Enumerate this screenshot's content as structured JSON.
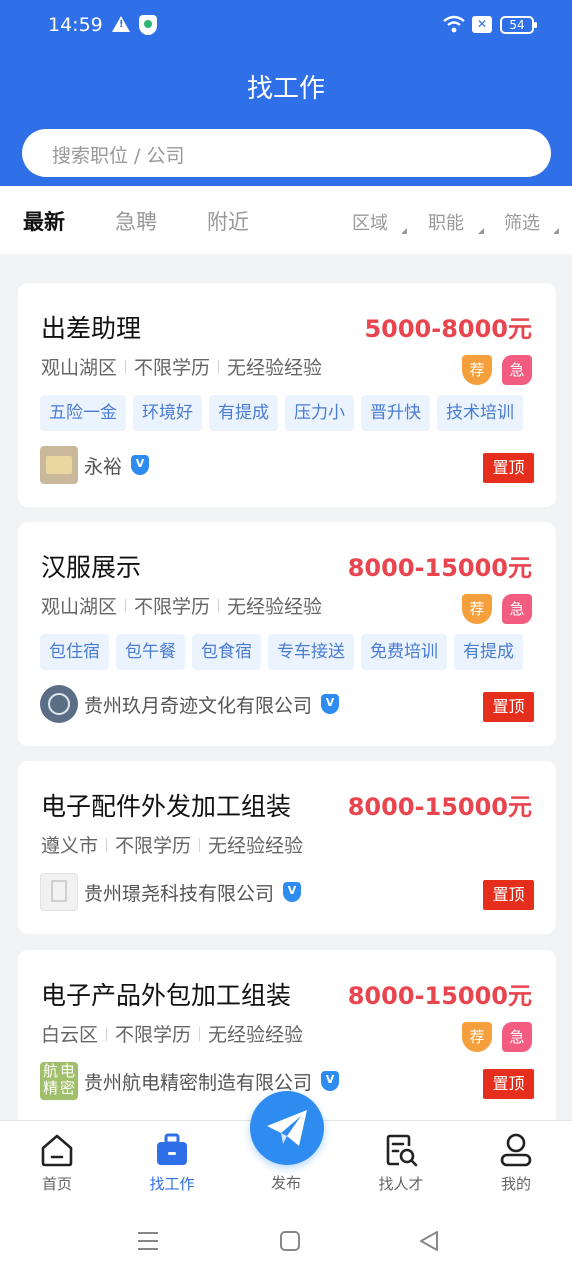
{
  "status_bar": {
    "time": "14:59",
    "battery": "54"
  },
  "header": {
    "title": "找工作"
  },
  "search": {
    "placeholder": "搜索职位 / 公司"
  },
  "tabs": [
    {
      "label": "最新",
      "active": true
    },
    {
      "label": "急聘",
      "active": false
    },
    {
      "label": "附近",
      "active": false
    }
  ],
  "filters": [
    {
      "label": "区域"
    },
    {
      "label": "职能"
    },
    {
      "label": "筛选"
    }
  ],
  "jobs": [
    {
      "title": "出差助理",
      "salary": "5000-8000元",
      "meta": [
        "观山湖区",
        "不限学历",
        "无经验经验"
      ],
      "badges": [
        "荐",
        "急"
      ],
      "tags": [
        "五险一金",
        "环境好",
        "有提成",
        "压力小",
        "晋升快",
        "技术培训"
      ],
      "company": "永裕",
      "verified": "V",
      "pin": "置顶"
    },
    {
      "title": "汉服展示",
      "salary": "8000-15000元",
      "meta": [
        "观山湖区",
        "不限学历",
        "无经验经验"
      ],
      "badges": [
        "荐",
        "急"
      ],
      "tags": [
        "包住宿",
        "包午餐",
        "包食宿",
        "专车接送",
        "免费培训",
        "有提成"
      ],
      "company": "贵州玖月奇迹文化有限公司",
      "verified": "V",
      "pin": "置顶"
    },
    {
      "title": "电子配件外发加工组装",
      "salary": "8000-15000元",
      "meta": [
        "遵义市",
        "不限学历",
        "无经验经验"
      ],
      "badges": [],
      "tags": [],
      "company": "贵州璟尧科技有限公司",
      "verified": "V",
      "pin": "置顶"
    },
    {
      "title": "电子产品外包加工组装",
      "salary": "8000-15000元",
      "meta": [
        "白云区",
        "不限学历",
        "无经验经验"
      ],
      "badges": [
        "荐",
        "急"
      ],
      "tags": [],
      "company": "贵州航电精密制造有限公司",
      "logo_text": [
        "航",
        "电",
        "精",
        "密"
      ],
      "verified": "V",
      "pin": "置顶"
    }
  ],
  "bottom_nav": [
    {
      "label": "首页",
      "icon": "home-icon"
    },
    {
      "label": "找工作",
      "icon": "briefcase-icon",
      "active": true
    },
    {
      "label": "发布",
      "icon": "paper-plane-icon"
    },
    {
      "label": "找人才",
      "icon": "resume-search-icon"
    },
    {
      "label": "我的",
      "icon": "user-icon"
    }
  ],
  "colors": {
    "primary": "#2f6fe8",
    "salary": "#e8454f",
    "pin": "#e62e1c",
    "tag_text": "#4a7cd0",
    "tag_bg": "#eaf3fe"
  }
}
